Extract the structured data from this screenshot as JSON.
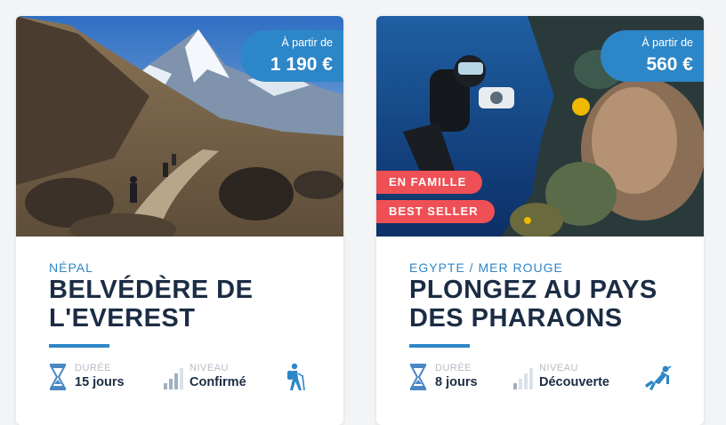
{
  "cards": [
    {
      "price": {
        "label": "À partir de",
        "value": "1 190 €"
      },
      "badges": [],
      "country": "NÉPAL",
      "title": "BELVÉDÈRE DE L'EVEREST",
      "duration": {
        "label": "DURÉE",
        "value": "15 jours"
      },
      "level": {
        "label": "NIVEAU",
        "value": "Confirmé"
      },
      "activity_icon": "hiker-icon"
    },
    {
      "price": {
        "label": "À partir de",
        "value": "560 €"
      },
      "badges": [
        "EN FAMILLE",
        "BEST SELLER"
      ],
      "country": "EGYPTE / MER ROUGE",
      "title": "PLONGEZ AU PAYS DES PHARAONS",
      "duration": {
        "label": "DURÉE",
        "value": "8 jours"
      },
      "level": {
        "label": "NIVEAU",
        "value": "Découverte"
      },
      "activity_icon": "diver-icon"
    }
  ],
  "colors": {
    "accent": "#2d86c7",
    "badge": "#ef5055",
    "title": "#1b2c44",
    "muted": "#b5bcc5"
  }
}
